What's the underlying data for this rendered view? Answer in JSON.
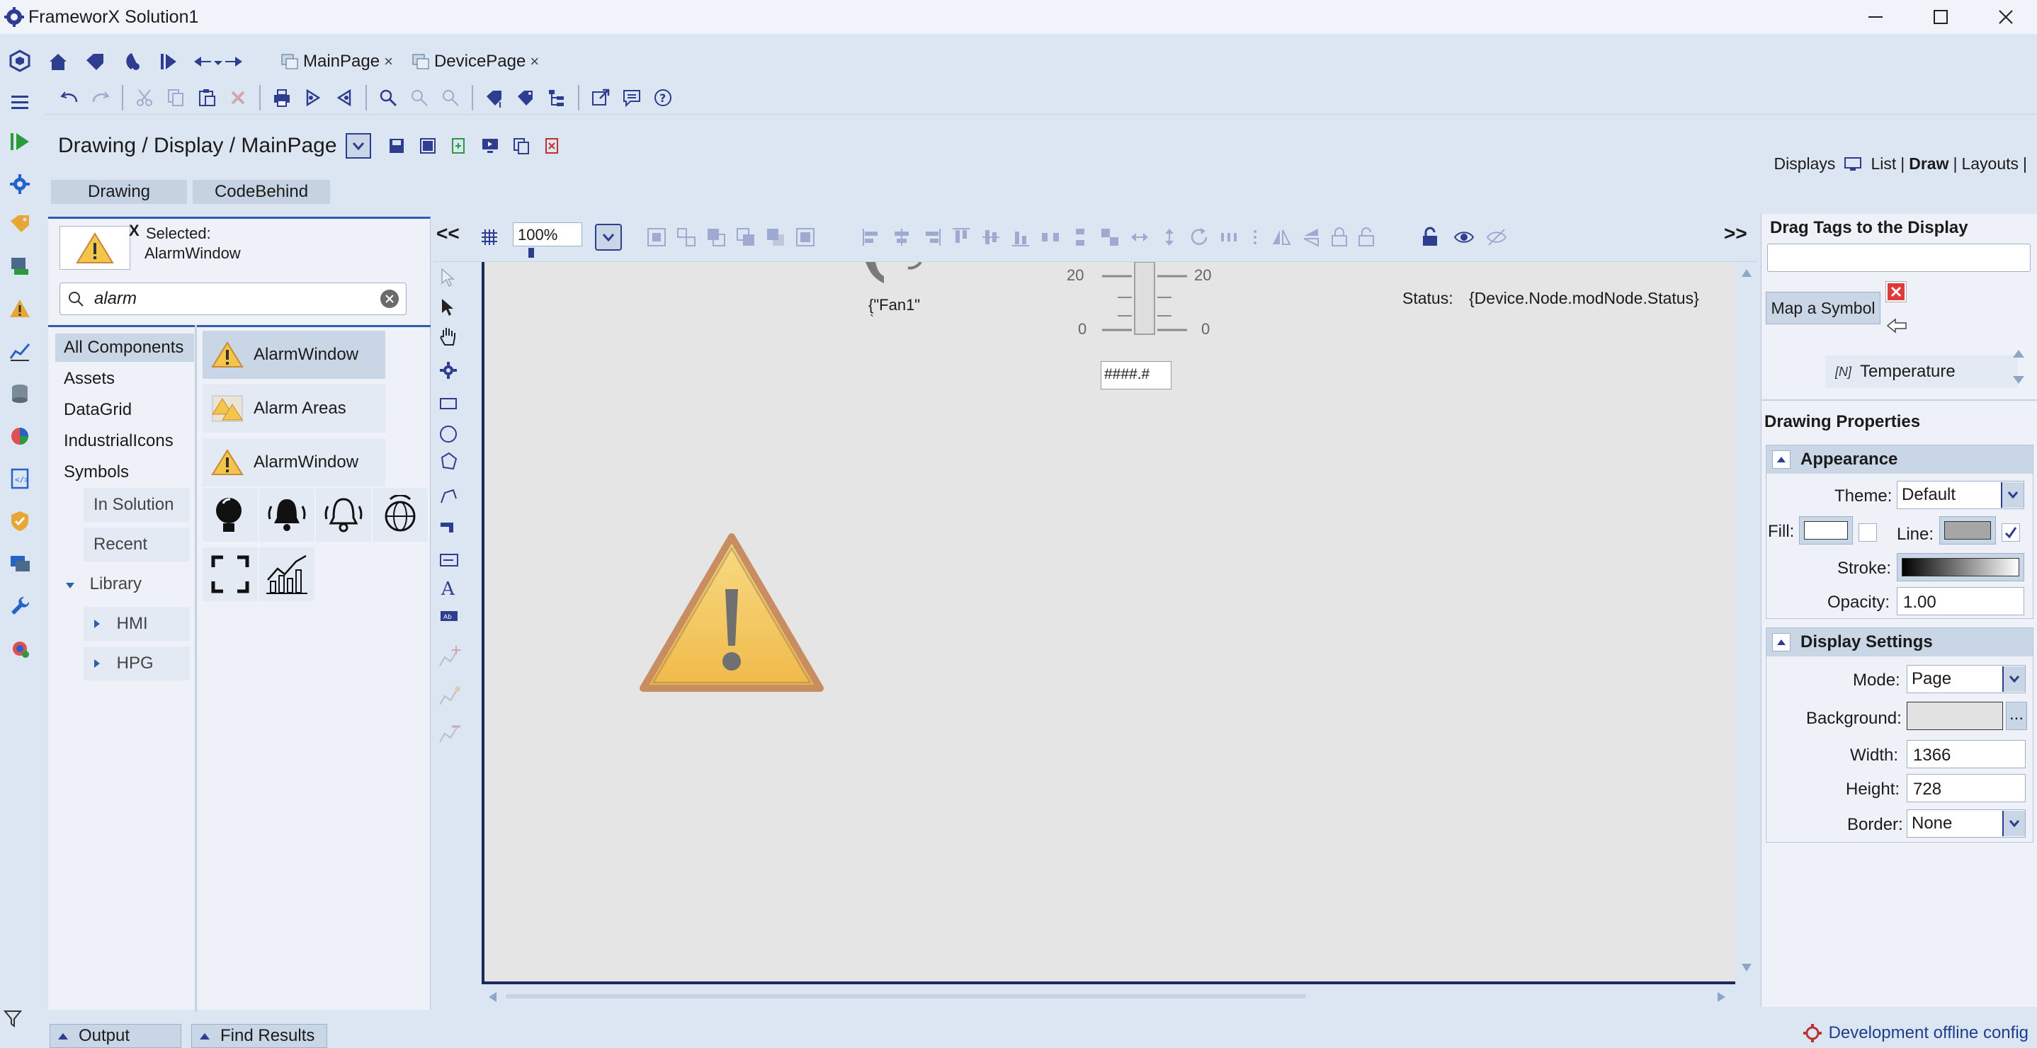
{
  "window": {
    "title": "FrameworX Solution1"
  },
  "tabs": [
    {
      "label": "MainPage"
    },
    {
      "label": "DevicePage"
    }
  ],
  "breadcrumb": "Drawing / Display / MainPage",
  "view_links": {
    "displays": "Displays",
    "list": "List",
    "sep1": "|",
    "draw": "Draw",
    "sep2": "|",
    "layouts": "Layouts",
    "sep3": "|"
  },
  "subtabs": {
    "drawing": "Drawing",
    "codebehind": "CodeBehind"
  },
  "selected": {
    "close": "X",
    "label": "Selected:",
    "name": "AlarmWindow"
  },
  "search": {
    "value": "alarm"
  },
  "categories": {
    "all": "All Components",
    "assets": "Assets",
    "datagrid": "DataGrid",
    "industrial": "IndustrialIcons",
    "symbols": "Symbols",
    "in_solution": "In Solution",
    "recent": "Recent",
    "library": "Library",
    "hmi": "HMI",
    "hpg": "HPG"
  },
  "components": [
    {
      "label": "AlarmWindow"
    },
    {
      "label": "Alarm Areas"
    },
    {
      "label": "AlarmWindow"
    }
  ],
  "canvas_toolbar": {
    "collapse_left": "<<",
    "zoom": "100%",
    "expand_right": ">>"
  },
  "canvas": {
    "gauge_top_left": "20",
    "gauge_top_right": "20",
    "gauge_bottom_left": "0",
    "gauge_bottom_right": "0",
    "fan_label": "{\"Fan1\"",
    "fan_tick": "`",
    "status_label": "Status:",
    "status_value": "{Device.Node.modNode.Status}",
    "numeric_display": "####.#"
  },
  "right_panel": {
    "drag_title": "Drag Tags to the Display",
    "map_symbol": "Map a Symbol",
    "tag_type": "[N]",
    "tag_item": "Temperature",
    "drawing_properties": "Drawing Properties",
    "appearance": {
      "title": "Appearance",
      "theme_label": "Theme:",
      "theme_value": "Default",
      "fill_label": "Fill:",
      "line_label": "Line:",
      "stroke_label": "Stroke:",
      "opacity_label": "Opacity:",
      "opacity_value": "1.00"
    },
    "display_settings": {
      "title": "Display Settings",
      "mode_label": "Mode:",
      "mode_value": "Page",
      "background_label": "Background:",
      "background_button": "...",
      "width_label": "Width:",
      "width_value": "1366",
      "height_label": "Height:",
      "height_value": "728",
      "border_label": "Border:",
      "border_value": "None"
    }
  },
  "bottom": {
    "output": "Output",
    "find_results": "Find Results",
    "status": "Development offline config"
  },
  "colors": {
    "accent_blue": "#2e3d8f",
    "panel_bg": "#dce6f2",
    "canvas_bg": "#e5e5e5",
    "warning_yellow": "#f3c54a"
  }
}
